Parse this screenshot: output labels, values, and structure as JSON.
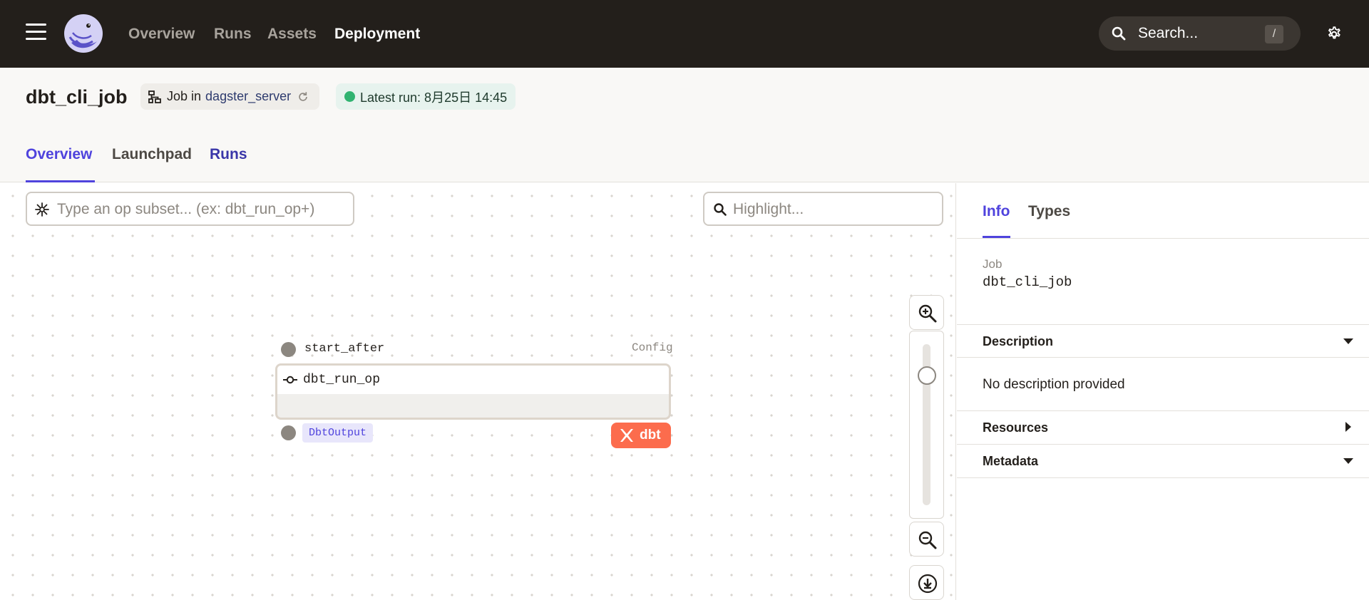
{
  "nav": {
    "links": [
      "Overview",
      "Runs",
      "Assets",
      "Deployment"
    ],
    "active": "Deployment",
    "search_placeholder": "Search...",
    "search_shortcut": "/"
  },
  "header": {
    "title": "dbt_cli_job",
    "job_prefix": "Job in",
    "repository": "dagster_server",
    "latest_run": "Latest run: 8月25日 14:45",
    "tabs": [
      "Overview",
      "Launchpad",
      "Runs"
    ],
    "active_tab": "Overview"
  },
  "graph": {
    "op_subset_placeholder": "Type an op subset... (ex: dbt_run_op+)",
    "highlight_placeholder": "Highlight...",
    "node": {
      "input_name": "start_after",
      "config_label": "Config",
      "name": "dbt_run_op",
      "output_type": "DbtOutput",
      "kind_badge": "dbt"
    }
  },
  "side_panel": {
    "tabs": [
      "Info",
      "Types"
    ],
    "active_tab": "Info",
    "job_label": "Job",
    "job_name": "dbt_cli_job",
    "sections": {
      "description": "Description",
      "description_text": "No description provided",
      "resources": "Resources",
      "metadata": "Metadata"
    }
  },
  "colors": {
    "accent": "#4f43dd",
    "nav_bg": "#231f1b",
    "success": "#30b370",
    "dbt": "#fc6c4d"
  }
}
